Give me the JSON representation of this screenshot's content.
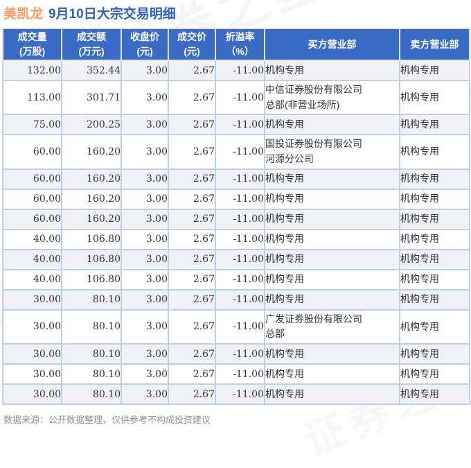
{
  "title": {
    "stock_name": "美凯龙",
    "report_title": "9月10日大宗交易明细"
  },
  "chart_data": {
    "type": "table",
    "title": "美凯龙 9月10日大宗交易明细",
    "columns": [
      "成交量(万股)",
      "成交额(万元)",
      "收盘价(元)",
      "成交价(元)",
      "折溢率(%)",
      "买方营业部",
      "卖方营业部"
    ],
    "rows": [
      [
        "132.00",
        "352.44",
        "3.00",
        "2.67",
        "-11.00",
        "机构专用",
        "机构专用"
      ],
      [
        "113.00",
        "301.71",
        "3.00",
        "2.67",
        "-11.00",
        "中信证券股份有限公司\n总部(非营业场所)",
        "机构专用"
      ],
      [
        "75.00",
        "200.25",
        "3.00",
        "2.67",
        "-11.00",
        "机构专用",
        "机构专用"
      ],
      [
        "60.00",
        "160.20",
        "3.00",
        "2.67",
        "-11.00",
        "国投证券股份有限公司\n河源分公司",
        "机构专用"
      ],
      [
        "60.00",
        "160.20",
        "3.00",
        "2.67",
        "-11.00",
        "机构专用",
        "机构专用"
      ],
      [
        "60.00",
        "160.20",
        "3.00",
        "2.67",
        "-11.00",
        "机构专用",
        "机构专用"
      ],
      [
        "60.00",
        "160.20",
        "3.00",
        "2.67",
        "-11.00",
        "机构专用",
        "机构专用"
      ],
      [
        "40.00",
        "106.80",
        "3.00",
        "2.67",
        "-11.00",
        "机构专用",
        "机构专用"
      ],
      [
        "40.00",
        "106.80",
        "3.00",
        "2.67",
        "-11.00",
        "机构专用",
        "机构专用"
      ],
      [
        "40.00",
        "106.80",
        "3.00",
        "2.67",
        "-11.00",
        "机构专用",
        "机构专用"
      ],
      [
        "30.00",
        "80.10",
        "3.00",
        "2.67",
        "-11.00",
        "机构专用",
        "机构专用"
      ],
      [
        "30.00",
        "80.10",
        "3.00",
        "2.67",
        "-11.00",
        "广发证券股份有限公司\n总部",
        "机构专用"
      ],
      [
        "30.00",
        "80.10",
        "3.00",
        "2.67",
        "-11.00",
        "机构专用",
        "机构专用"
      ],
      [
        "30.00",
        "80.10",
        "3.00",
        "2.67",
        "-11.00",
        "机构专用",
        "机构专用"
      ],
      [
        "30.00",
        "80.10",
        "3.00",
        "2.67",
        "-11.00",
        "机构专用",
        "机构专用"
      ]
    ]
  },
  "table": {
    "header_lines": [
      "成交量\n(万股)",
      "成交额\n(万元)",
      "收盘价\n(元)",
      "成交价\n(元)",
      "折溢率\n（%）",
      "买方营业部",
      "卖方营业部"
    ]
  },
  "footer": {
    "text": "数据来源：公开数据整理，仅供参考不构成投资建议"
  },
  "watermark": {
    "text": "证券之星"
  },
  "colors": {
    "header_bg": "#3A6BC7",
    "header_text": "#FFFFFF",
    "title_stock_orange": "#F99B5F",
    "title_blue": "#2D5FC4",
    "premium_green": "#0DA00D",
    "alt_row_bg": "#EFF1F4",
    "cell_border": "#BCD0EA",
    "footer_gray": "#8F8F8F"
  }
}
